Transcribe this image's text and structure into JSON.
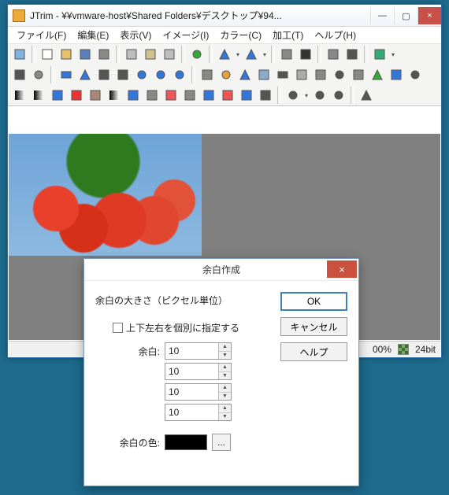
{
  "window": {
    "title": "JTrim - ¥¥vmware-host¥Shared Folders¥デスクトップ¥94...",
    "min": "—",
    "max": "▢",
    "close": "×"
  },
  "menu": {
    "file": "ファイル(F)",
    "edit": "編集(E)",
    "view": "表示(V)",
    "image": "イメージ(I)",
    "color": "カラー(C)",
    "process": "加工(T)",
    "help": "ヘルプ(H)"
  },
  "status": {
    "zoom": "00%",
    "depth": "24bit"
  },
  "dialog": {
    "title": "余白作成",
    "close": "×",
    "size_label": "余白の大きさ（ピクセル単位）",
    "checkbox_label": "上下左右を個別に指定する",
    "margin_label": "余白:",
    "values": {
      "v1": "10",
      "v2": "10",
      "v3": "10",
      "v4": "10"
    },
    "color_label": "余白の色:",
    "pick": "...",
    "ok": "OK",
    "cancel": "キャンセル",
    "helpbtn": "ヘルプ"
  }
}
